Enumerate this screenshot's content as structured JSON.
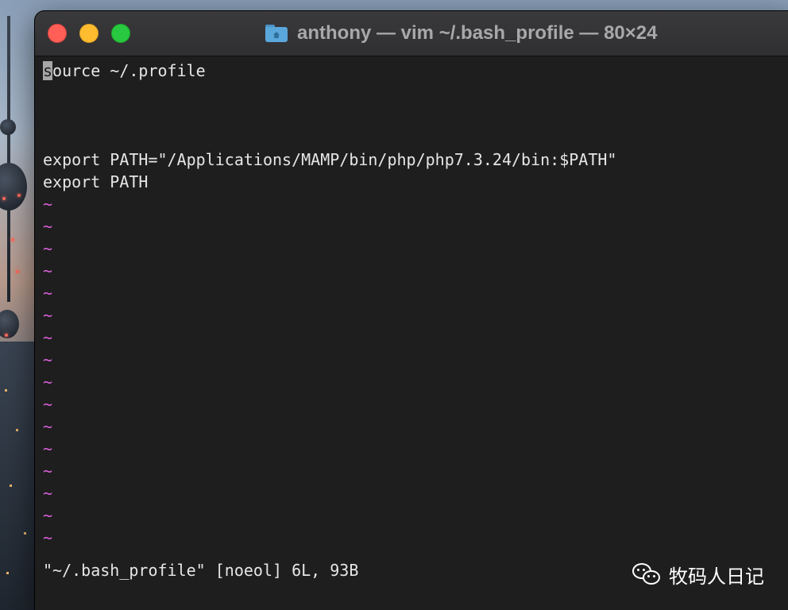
{
  "window": {
    "title": "anthony — vim ~/.bash_profile — 80×24",
    "title_icon": "home-folder-icon",
    "buttons": [
      "close",
      "minimize",
      "zoom"
    ],
    "colors": {
      "background": "#1e1e1e",
      "text": "#e6e6e6",
      "tilde": "#d65fd6",
      "close": "#ff5f57",
      "minimize": "#febc2e",
      "zoom": "#28c840"
    }
  },
  "editor": {
    "cursor_char": "s",
    "lines": [
      "ource ~/.profile",
      "",
      "",
      "",
      "export PATH=\"/Applications/MAMP/bin/php/php7.3.24/bin:$PATH\"",
      "export PATH"
    ],
    "empty_marker": "~",
    "empty_line_count": 16,
    "status_line": "\"~/.bash_profile\" [noeol] 6L, 93B"
  },
  "watermark": {
    "icon": "wechat-icon",
    "text": "牧码人日记"
  }
}
